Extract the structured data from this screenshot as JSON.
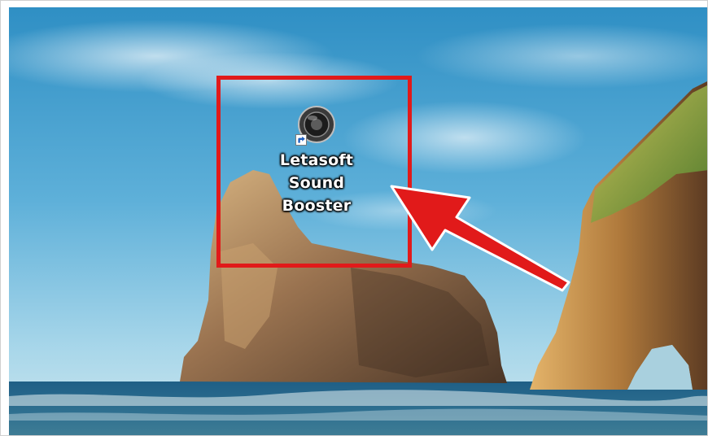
{
  "desktop": {
    "icons": [
      {
        "label_lines": [
          "Letasoft",
          "Sound",
          "Booster"
        ],
        "icon": "speaker-icon",
        "is_shortcut": true
      }
    ]
  },
  "annotation": {
    "highlight_color": "#e11a1a",
    "arrow_color": "#e11a1a"
  }
}
